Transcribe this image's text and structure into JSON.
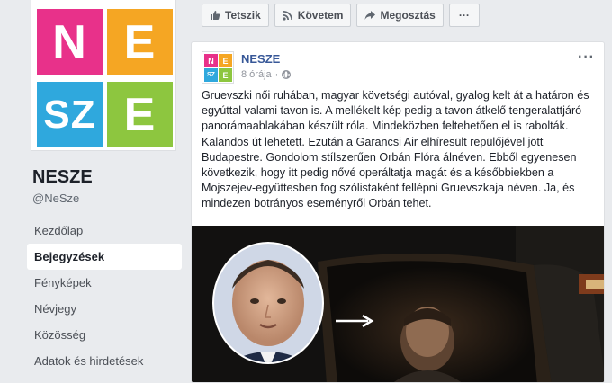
{
  "page": {
    "logo_letters": [
      "N",
      "E",
      "SZ",
      "E"
    ],
    "name": "NESZE",
    "handle": "@NeSze"
  },
  "nav": {
    "items": [
      {
        "label": "Kezdőlap"
      },
      {
        "label": "Bejegyzések"
      },
      {
        "label": "Fényképek"
      },
      {
        "label": "Névjegy"
      },
      {
        "label": "Közösség"
      },
      {
        "label": "Adatok és hirdetések"
      }
    ],
    "active_index": 1
  },
  "actions": {
    "like_label": "Tetszik",
    "follow_label": "Követem",
    "share_label": "Megosztás",
    "more_label": "···"
  },
  "post": {
    "author": "NESZE",
    "time": "8 órája",
    "more_label": "···",
    "text": "Gruevszki női ruhában, magyar követségi autóval, gyalog kelt át a határon és egyúttal valami tavon is. A mellékelt kép pedig a tavon átkelő tengeralattjáró panorámaablakában készült róla. Mindeközben feltehetően el is rabolták. Kalandos út lehetett. Ezután a Garancsi Air elhíresült repülőjével jött Budapestre. Gondolom stílszerűen Orbán Flóra álnéven. Ebből egyenesen következik, hogy itt pedig nővé operáltatja magát és a későbbiekben a Mojszejev-együttesben fog szólistaként fellépni Gruevszkaja néven. Ja, és mindezen botrányos eseményről Orbán tehet."
  },
  "colors": {
    "pink": "#e8318a",
    "orange": "#f5a623",
    "blue": "#2fa8dd",
    "green": "#8dc63f",
    "link": "#385898"
  }
}
